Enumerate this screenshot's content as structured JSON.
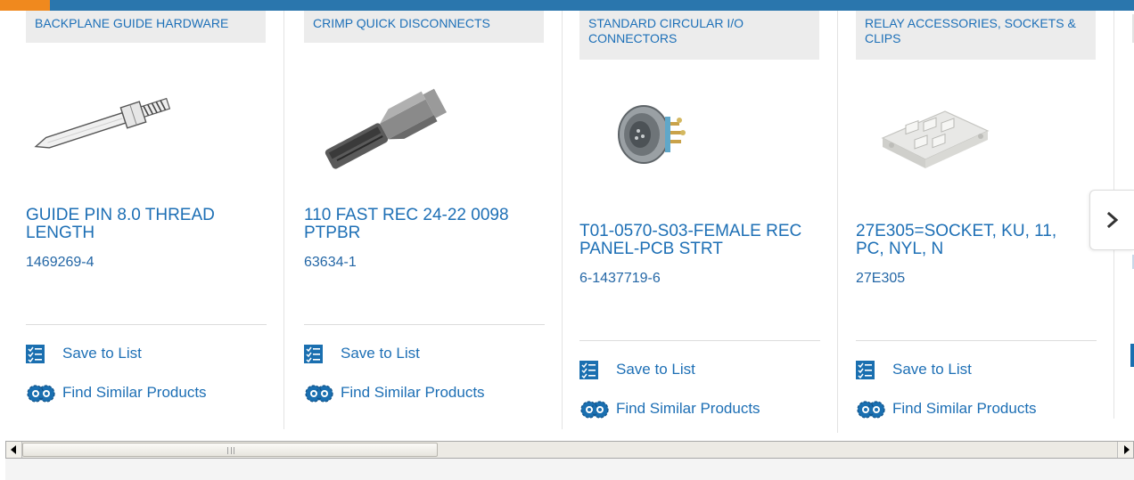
{
  "products": [
    {
      "category": "BACKPLANE GUIDE HARDWARE",
      "title": "GUIDE PIN 8.0 THREAD LENGTH",
      "part_number": "1469269-4",
      "save_label": "Save to List",
      "find_label": "Find Similar Products",
      "image_icon": "guide-pin-image"
    },
    {
      "category": "CRIMP QUICK DISCONNECTS",
      "title": "110 FAST REC 24-22 0098 PTPBR",
      "part_number": "63634-1",
      "save_label": "Save to List",
      "find_label": "Find Similar Products",
      "image_icon": "quick-disconnect-image"
    },
    {
      "category": "STANDARD CIRCULAR I/O CONNECTORS",
      "title": "T01-0570-S03-FEMALE REC PANEL-PCB STRT",
      "part_number": "6-1437719-6",
      "save_label": "Save to List",
      "find_label": "Find Similar Products",
      "image_icon": "circular-connector-image"
    },
    {
      "category": "RELAY ACCESSORIES, SOCKETS & CLIPS",
      "title": "27E305=SOCKET, KU, 11, PC, NYL, N",
      "part_number": "27E305",
      "save_label": "Save to List",
      "find_label": "Find Similar Products",
      "image_icon": "relay-socket-image"
    }
  ],
  "carousel": {
    "next_icon": "chevron-right-icon"
  },
  "colors": {
    "brand_blue": "#2a76ad",
    "accent_orange": "#f0891e",
    "link_blue": "#1d6fb5",
    "icon_blue": "#1a6fb0",
    "category_bg": "#ececec"
  }
}
